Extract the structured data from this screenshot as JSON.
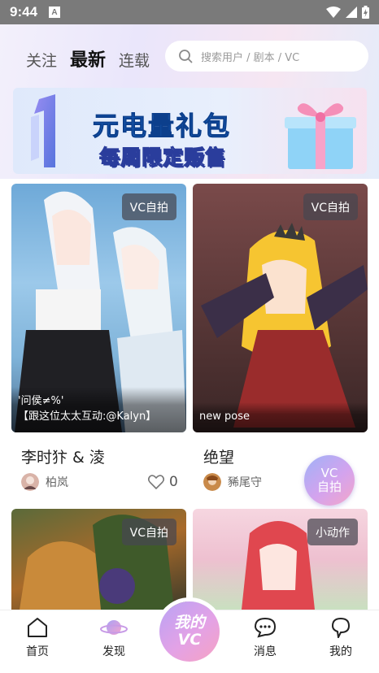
{
  "status_bar": {
    "time": "9:44",
    "notification_letter": "A"
  },
  "header": {
    "tabs": [
      {
        "label": "关注",
        "active": false
      },
      {
        "label": "最新",
        "active": true
      },
      {
        "label": "连载",
        "active": false
      }
    ],
    "search": {
      "placeholder": "搜索用户 / 剧本 / VC",
      "icon": "search-icon"
    }
  },
  "banner": {
    "title": "元电量礼包",
    "subtitle": "每周限定贩售"
  },
  "posts": [
    {
      "tag": "VC自拍",
      "caption_line1": "'问侯≠%'",
      "caption_line2": "【跟这位太太互动:@Kalyn】",
      "title": "李时犿 & 淩",
      "author": "柏岚",
      "likes": "0"
    },
    {
      "tag": "VC自拍",
      "caption_line1": "new pose",
      "title": "绝望",
      "author": "豨尾守"
    },
    {
      "tag": "VC自拍"
    },
    {
      "tag": "小动作"
    }
  ],
  "float_button": {
    "line1": "VC",
    "line2": "自拍"
  },
  "bottom_nav": {
    "items": [
      {
        "label": "首页",
        "icon": "home-icon"
      },
      {
        "label": "发现",
        "icon": "planet-icon"
      },
      {
        "label": "消息",
        "icon": "message-icon"
      },
      {
        "label": "我的",
        "icon": "profile-icon"
      }
    ],
    "center": {
      "line1": "我的",
      "line2": "VC"
    }
  },
  "colors": {
    "accent": "#1e6dd0",
    "center_gradient_start": "#b9a3f5",
    "center_gradient_end": "#f6a2c2"
  }
}
